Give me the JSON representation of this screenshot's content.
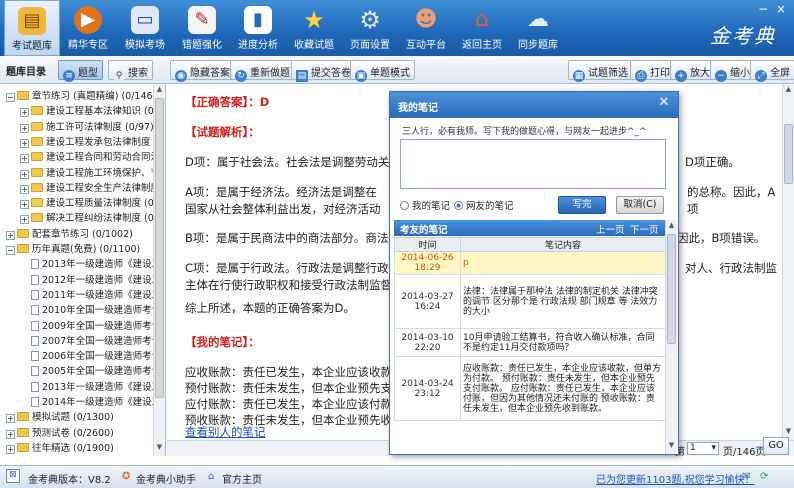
{
  "topbar": {
    "buttons": [
      {
        "label": "考试题库",
        "icon": "book-icon",
        "active": true
      },
      {
        "label": "精华专区",
        "icon": "play-icon"
      },
      {
        "label": "模拟考场",
        "icon": "monitor-icon"
      },
      {
        "label": "错题强化",
        "icon": "error-book-icon"
      },
      {
        "label": "进度分析",
        "icon": "bar-chart-icon"
      },
      {
        "label": "收藏试题",
        "icon": "star-icon"
      },
      {
        "label": "页面设置",
        "icon": "gear-icon"
      },
      {
        "label": "互动平台",
        "icon": "people-icon"
      },
      {
        "label": "返回主页",
        "icon": "home-icon"
      },
      {
        "label": "同步题库",
        "icon": "cloud-sync-icon"
      }
    ],
    "logo": "金考典"
  },
  "subbar": {
    "title": "题库目录",
    "tab_questions": "题型",
    "tab_search": "搜索",
    "hide_answer": "隐藏答案",
    "redo": "重新做题",
    "submit": "提交答卷",
    "single_mode": "单题模式",
    "filter": "试题筛选",
    "print": "打印",
    "zoom_in": "放大",
    "zoom_out": "缩小",
    "fullscreen": "全屏"
  },
  "tree": [
    {
      "level": 0,
      "toggle": "−",
      "folder": true,
      "label": "章节练习 (真题精编) (0/1462)"
    },
    {
      "level": 1,
      "toggle": "+",
      "folder": true,
      "label": "建设工程基本法律知识 (0/230)"
    },
    {
      "level": 1,
      "toggle": "+",
      "folder": true,
      "label": "施工许可法律制度 (0/97)"
    },
    {
      "level": 1,
      "toggle": "+",
      "folder": true,
      "label": "建设工程发承包法律制度 (0/...)"
    },
    {
      "level": 1,
      "toggle": "+",
      "folder": true,
      "label": "建设工程合同和劳动合同法律"
    },
    {
      "level": 1,
      "toggle": "+",
      "folder": true,
      "label": "建设工程施工环境保护、节约"
    },
    {
      "level": 1,
      "toggle": "+",
      "folder": true,
      "label": "建设工程安全生产法律制度 (0"
    },
    {
      "level": 1,
      "toggle": "+",
      "folder": true,
      "label": "建设工程质量法律制度 (0/20"
    },
    {
      "level": 1,
      "toggle": "+",
      "folder": true,
      "label": "解决工程纠纷法律制度 (0/18"
    },
    {
      "level": 0,
      "toggle": "+",
      "folder": true,
      "label": "配套章节练习 (0/1002)"
    },
    {
      "level": 0,
      "toggle": "−",
      "folder": true,
      "label": "历年真题(免费) (0/1100)"
    },
    {
      "level": 1,
      "doc": true,
      "label": "2013年一级建造师《建设工程"
    },
    {
      "level": 1,
      "doc": true,
      "label": "2012年一级建造师《建设工程"
    },
    {
      "level": 1,
      "doc": true,
      "label": "2011年一级建造师《建设工程"
    },
    {
      "level": 1,
      "doc": true,
      "label": "2010年全国一级建造师考试《"
    },
    {
      "level": 1,
      "doc": true,
      "label": "2009年全国一级建造师考试《"
    },
    {
      "level": 1,
      "doc": true,
      "label": "2007年全国一级建造师考试《"
    },
    {
      "level": 1,
      "doc": true,
      "label": "2006年全国一级建造师考试《"
    },
    {
      "level": 1,
      "doc": true,
      "label": "2005年全国一级建造师考试《"
    },
    {
      "level": 1,
      "doc": true,
      "label": "2013年一级建造师《建设工程"
    },
    {
      "level": 1,
      "doc": true,
      "label": "2014年一级建造师《建设工程"
    },
    {
      "level": 0,
      "toggle": "+",
      "folder": true,
      "label": "模拟试题 (0/1300)"
    },
    {
      "level": 0,
      "toggle": "+",
      "folder": true,
      "label": "预测试卷 (0/2600)"
    },
    {
      "level": 0,
      "toggle": "+",
      "folder": true,
      "label": "往年精选 (0/1900)"
    }
  ],
  "main": {
    "correct_label": "【正确答案】：",
    "correct_value": "D",
    "analysis_label": "【试题解析】：",
    "para_d": "D项：属于社会法。社会法是调整劳动关系、社会保障和社会福利关系的法律规范的总称。",
    "para_d_tail": "D项正确。",
    "para_a": "A项：是属于经济法。经济法是调整在国家从社会整体利益出发，对经济活动实行干预、管理或者调控所产生的社会经济关系的法律规范的总称。因此，A项错误。",
    "para_b": "B项：是属于民商法中的商法部分。商法是调整平等主体之间商事关系的法律规范，",
    "para_b_tail": "因此，B项错误。",
    "para_c": "C项：是属于行政法。行政法是调整行政主体在行使行政职权和接受行政法制监督过程中与行政相对人、行政法制监督主体之间发生的各种关系，以及行政主体内部发生的各种关系的法律规范的总称。",
    "para_c_tail": "对人、行政法制监",
    "summary": "综上所述，本题的正确答案为D。",
    "note_label": "【我的笔记】：",
    "note_1": "应收账款：责任已发生，本企业应该收款",
    "note_2": "预付账款：责任未发生，但本企业预先支付账款",
    "note_3": "应付账款：责任已发生，本企业应该付款",
    "note_4": "预收账款：责任未发生，但本企业预先收到账款",
    "view_others": "查看别人的笔记"
  },
  "pager": {
    "prefix": "第",
    "page": "1",
    "suffix": "页/146页",
    "go": "GO"
  },
  "dialog": {
    "title": "我的笔记",
    "tip": "三人行，必有我师。写下我的做题心得，与网友一起进步^_^",
    "radio_mine": "我的笔记",
    "radio_friends": "网友的笔记",
    "write": "写完",
    "cancel": "取消(C)",
    "friend_title": "考友的笔记",
    "prev": "上一页",
    "next": "下一页",
    "col_time": "时间",
    "col_content": "笔记内容",
    "rows": [
      {
        "time": "2014-06-26 18:29",
        "content": "p",
        "highlight": true
      },
      {
        "time": "2014-03-27 16:24",
        "content": "法律：法律属于那种法 法律的制定机关 法律冲突的调节 区分那个是 行政法规 部门规章 等 法效力的大小"
      },
      {
        "time": "2014-03-10 22:20",
        "content": "10月申请验工结算书，符合收入确认标准，合同不是约定11月交付款项吗？"
      },
      {
        "time": "2014-03-24 23:12",
        "content": "应收账款：责任已发生，本企业应该收款，但单方为付款。 预付账款：责任未发生，但本企业预先支付账款。 应付账款：责任已发生，本企业应该付账，但因为其他情况还未付账的 预收账款：责任未发生，但本企业预先收到账款。"
      }
    ]
  },
  "status": {
    "version": "金考典版本：V8.2",
    "helper": "金考典小助手",
    "official": "官方主页",
    "update": "已为您更新1103题,祝您学习愉快！"
  },
  "colors": {
    "brand_blue": "#1f67b8",
    "answer_red": "#d0211c",
    "link_blue": "#1c55b5"
  }
}
